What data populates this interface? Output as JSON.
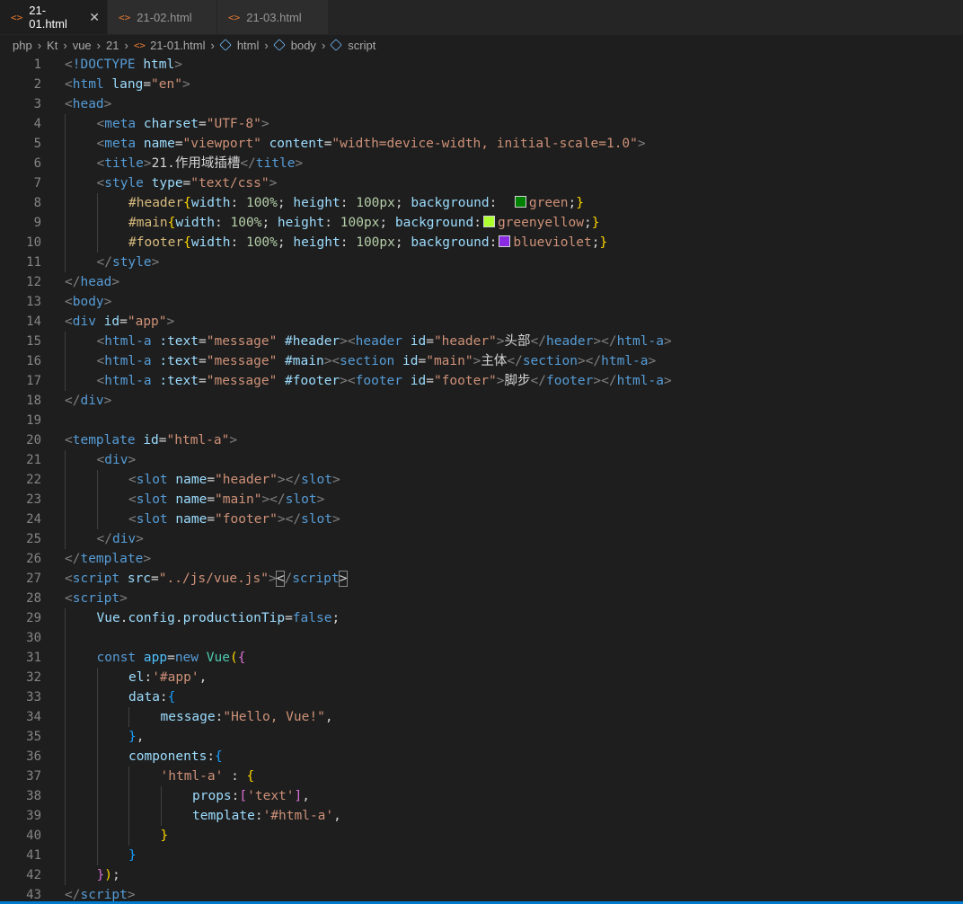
{
  "tabs": [
    {
      "label": "21-01.html",
      "active": true,
      "close": "✕"
    },
    {
      "label": "21-02.html",
      "active": false
    },
    {
      "label": "21-03.html",
      "active": false
    }
  ],
  "breadcrumb": [
    "php",
    "Kt",
    "vue",
    "21",
    "21-01.html",
    "html",
    "body",
    "script"
  ],
  "file_icon": "<>",
  "colors": {
    "green": "#008000",
    "greenyellow": "#adff2f",
    "blueviolet": "#8a2be2"
  },
  "lines": [
    {
      "n": "1",
      "i": 0,
      "t": [
        [
          "c-punc",
          "<"
        ],
        [
          "c-tag",
          "!DOCTYPE "
        ],
        [
          "c-attr",
          "html"
        ],
        [
          "c-punc",
          ">"
        ]
      ]
    },
    {
      "n": "2",
      "i": 0,
      "t": [
        [
          "c-punc",
          "<"
        ],
        [
          "c-tag",
          "html "
        ],
        [
          "c-attr",
          "lang"
        ],
        [
          "c-txt",
          "="
        ],
        [
          "c-str",
          "\"en\""
        ],
        [
          "c-punc",
          ">"
        ]
      ]
    },
    {
      "n": "3",
      "i": 0,
      "t": [
        [
          "c-punc",
          "<"
        ],
        [
          "c-tag",
          "head"
        ],
        [
          "c-punc",
          ">"
        ]
      ]
    },
    {
      "n": "4",
      "i": 1,
      "t": [
        [
          "c-punc",
          "<"
        ],
        [
          "c-tag",
          "meta "
        ],
        [
          "c-attr",
          "charset"
        ],
        [
          "c-txt",
          "="
        ],
        [
          "c-str",
          "\"UTF-8\""
        ],
        [
          "c-punc",
          ">"
        ]
      ]
    },
    {
      "n": "5",
      "i": 1,
      "t": [
        [
          "c-punc",
          "<"
        ],
        [
          "c-tag",
          "meta "
        ],
        [
          "c-attr",
          "name"
        ],
        [
          "c-txt",
          "="
        ],
        [
          "c-str",
          "\"viewport\" "
        ],
        [
          "c-attr",
          "content"
        ],
        [
          "c-txt",
          "="
        ],
        [
          "c-str",
          "\"width=device-width, initial-scale=1.0\""
        ],
        [
          "c-punc",
          ">"
        ]
      ]
    },
    {
      "n": "6",
      "i": 1,
      "t": [
        [
          "c-punc",
          "<"
        ],
        [
          "c-tag",
          "title"
        ],
        [
          "c-punc",
          ">"
        ],
        [
          "c-txt",
          "21.作用域插槽"
        ],
        [
          "c-punc",
          "</"
        ],
        [
          "c-tag",
          "title"
        ],
        [
          "c-punc",
          ">"
        ]
      ]
    },
    {
      "n": "7",
      "i": 1,
      "t": [
        [
          "c-punc",
          "<"
        ],
        [
          "c-tag",
          "style "
        ],
        [
          "c-attr",
          "type"
        ],
        [
          "c-txt",
          "="
        ],
        [
          "c-str",
          "\"text/css\""
        ],
        [
          "c-punc",
          ">"
        ]
      ]
    },
    {
      "n": "8",
      "i": 2,
      "t": [
        [
          "c-sel",
          "#header"
        ],
        [
          "c-br",
          "{"
        ],
        [
          "c-prop",
          "width"
        ],
        [
          "c-txt",
          ": "
        ],
        [
          "c-num",
          "100%"
        ],
        [
          "c-txt",
          "; "
        ],
        [
          "c-prop",
          "height"
        ],
        [
          "c-txt",
          ": "
        ],
        [
          "c-num",
          "100px"
        ],
        [
          "c-txt",
          "; "
        ],
        [
          "c-prop",
          "background"
        ],
        [
          "c-txt",
          ":  "
        ],
        [
          "swatch",
          "green"
        ],
        [
          "c-val",
          "green"
        ],
        [
          "c-txt",
          ";"
        ],
        [
          "c-br",
          "}"
        ]
      ]
    },
    {
      "n": "9",
      "i": 2,
      "t": [
        [
          "c-sel",
          "#main"
        ],
        [
          "c-br",
          "{"
        ],
        [
          "c-prop",
          "width"
        ],
        [
          "c-txt",
          ": "
        ],
        [
          "c-num",
          "100%"
        ],
        [
          "c-txt",
          "; "
        ],
        [
          "c-prop",
          "height"
        ],
        [
          "c-txt",
          ": "
        ],
        [
          "c-num",
          "100px"
        ],
        [
          "c-txt",
          "; "
        ],
        [
          "c-prop",
          "background"
        ],
        [
          "c-txt",
          ":"
        ],
        [
          "swatch",
          "greenyellow"
        ],
        [
          "c-val",
          "greenyellow"
        ],
        [
          "c-txt",
          ";"
        ],
        [
          "c-br",
          "}"
        ]
      ]
    },
    {
      "n": "10",
      "i": 2,
      "t": [
        [
          "c-sel",
          "#footer"
        ],
        [
          "c-br",
          "{"
        ],
        [
          "c-prop",
          "width"
        ],
        [
          "c-txt",
          ": "
        ],
        [
          "c-num",
          "100%"
        ],
        [
          "c-txt",
          "; "
        ],
        [
          "c-prop",
          "height"
        ],
        [
          "c-txt",
          ": "
        ],
        [
          "c-num",
          "100px"
        ],
        [
          "c-txt",
          "; "
        ],
        [
          "c-prop",
          "background"
        ],
        [
          "c-txt",
          ":"
        ],
        [
          "swatch",
          "blueviolet"
        ],
        [
          "c-val",
          "blueviolet"
        ],
        [
          "c-txt",
          ";"
        ],
        [
          "c-br",
          "}"
        ]
      ]
    },
    {
      "n": "11",
      "i": 1,
      "t": [
        [
          "c-punc",
          "</"
        ],
        [
          "c-tag",
          "style"
        ],
        [
          "c-punc",
          ">"
        ]
      ]
    },
    {
      "n": "12",
      "i": 0,
      "t": [
        [
          "c-punc",
          "</"
        ],
        [
          "c-tag",
          "head"
        ],
        [
          "c-punc",
          ">"
        ]
      ]
    },
    {
      "n": "13",
      "i": 0,
      "t": [
        [
          "c-punc",
          "<"
        ],
        [
          "c-tag",
          "body"
        ],
        [
          "c-punc",
          ">"
        ]
      ]
    },
    {
      "n": "14",
      "i": 0,
      "t": [
        [
          "c-punc",
          "<"
        ],
        [
          "c-tag",
          "div "
        ],
        [
          "c-attr",
          "id"
        ],
        [
          "c-txt",
          "="
        ],
        [
          "c-str",
          "\"app\""
        ],
        [
          "c-punc",
          ">"
        ]
      ]
    },
    {
      "n": "15",
      "i": 1,
      "t": [
        [
          "c-punc",
          "<"
        ],
        [
          "c-tag",
          "html-a "
        ],
        [
          "c-attr",
          ":text"
        ],
        [
          "c-txt",
          "="
        ],
        [
          "c-str",
          "\"message\" "
        ],
        [
          "c-attr",
          "#header"
        ],
        [
          "c-punc",
          "><"
        ],
        [
          "c-tag",
          "header "
        ],
        [
          "c-attr",
          "id"
        ],
        [
          "c-txt",
          "="
        ],
        [
          "c-str",
          "\"header\""
        ],
        [
          "c-punc",
          ">"
        ],
        [
          "c-txt",
          "头部"
        ],
        [
          "c-punc",
          "</"
        ],
        [
          "c-tag",
          "header"
        ],
        [
          "c-punc",
          "></"
        ],
        [
          "c-tag",
          "html-a"
        ],
        [
          "c-punc",
          ">"
        ]
      ]
    },
    {
      "n": "16",
      "i": 1,
      "t": [
        [
          "c-punc",
          "<"
        ],
        [
          "c-tag",
          "html-a "
        ],
        [
          "c-attr",
          ":text"
        ],
        [
          "c-txt",
          "="
        ],
        [
          "c-str",
          "\"message\" "
        ],
        [
          "c-attr",
          "#main"
        ],
        [
          "c-punc",
          "><"
        ],
        [
          "c-tag",
          "section "
        ],
        [
          "c-attr",
          "id"
        ],
        [
          "c-txt",
          "="
        ],
        [
          "c-str",
          "\"main\""
        ],
        [
          "c-punc",
          ">"
        ],
        [
          "c-txt",
          "主体"
        ],
        [
          "c-punc",
          "</"
        ],
        [
          "c-tag",
          "section"
        ],
        [
          "c-punc",
          "></"
        ],
        [
          "c-tag",
          "html-a"
        ],
        [
          "c-punc",
          ">"
        ]
      ]
    },
    {
      "n": "17",
      "i": 1,
      "t": [
        [
          "c-punc",
          "<"
        ],
        [
          "c-tag",
          "html-a "
        ],
        [
          "c-attr",
          ":text"
        ],
        [
          "c-txt",
          "="
        ],
        [
          "c-str",
          "\"message\" "
        ],
        [
          "c-attr",
          "#footer"
        ],
        [
          "c-punc",
          "><"
        ],
        [
          "c-tag",
          "footer "
        ],
        [
          "c-attr",
          "id"
        ],
        [
          "c-txt",
          "="
        ],
        [
          "c-str",
          "\"footer\""
        ],
        [
          "c-punc",
          ">"
        ],
        [
          "c-txt",
          "脚步"
        ],
        [
          "c-punc",
          "</"
        ],
        [
          "c-tag",
          "footer"
        ],
        [
          "c-punc",
          "></"
        ],
        [
          "c-tag",
          "html-a"
        ],
        [
          "c-punc",
          ">"
        ]
      ]
    },
    {
      "n": "18",
      "i": 0,
      "t": [
        [
          "c-punc",
          "</"
        ],
        [
          "c-tag",
          "div"
        ],
        [
          "c-punc",
          ">"
        ]
      ]
    },
    {
      "n": "19",
      "i": 0,
      "t": []
    },
    {
      "n": "20",
      "i": 0,
      "t": [
        [
          "c-punc",
          "<"
        ],
        [
          "c-tag",
          "template "
        ],
        [
          "c-attr",
          "id"
        ],
        [
          "c-txt",
          "="
        ],
        [
          "c-str",
          "\"html-a\""
        ],
        [
          "c-punc",
          ">"
        ]
      ]
    },
    {
      "n": "21",
      "i": 1,
      "t": [
        [
          "c-punc",
          "<"
        ],
        [
          "c-tag",
          "div"
        ],
        [
          "c-punc",
          ">"
        ]
      ]
    },
    {
      "n": "22",
      "i": 2,
      "t": [
        [
          "c-punc",
          "<"
        ],
        [
          "c-tag",
          "slot "
        ],
        [
          "c-attr",
          "name"
        ],
        [
          "c-txt",
          "="
        ],
        [
          "c-str",
          "\"header\""
        ],
        [
          "c-punc",
          "></"
        ],
        [
          "c-tag",
          "slot"
        ],
        [
          "c-punc",
          ">"
        ]
      ]
    },
    {
      "n": "23",
      "i": 2,
      "t": [
        [
          "c-punc",
          "<"
        ],
        [
          "c-tag",
          "slot "
        ],
        [
          "c-attr",
          "name"
        ],
        [
          "c-txt",
          "="
        ],
        [
          "c-str",
          "\"main\""
        ],
        [
          "c-punc",
          "></"
        ],
        [
          "c-tag",
          "slot"
        ],
        [
          "c-punc",
          ">"
        ]
      ]
    },
    {
      "n": "24",
      "i": 2,
      "t": [
        [
          "c-punc",
          "<"
        ],
        [
          "c-tag",
          "slot "
        ],
        [
          "c-attr",
          "name"
        ],
        [
          "c-txt",
          "="
        ],
        [
          "c-str",
          "\"footer\""
        ],
        [
          "c-punc",
          "></"
        ],
        [
          "c-tag",
          "slot"
        ],
        [
          "c-punc",
          ">"
        ]
      ]
    },
    {
      "n": "25",
      "i": 1,
      "t": [
        [
          "c-punc",
          "</"
        ],
        [
          "c-tag",
          "div"
        ],
        [
          "c-punc",
          ">"
        ]
      ]
    },
    {
      "n": "26",
      "i": 0,
      "t": [
        [
          "c-punc",
          "</"
        ],
        [
          "c-tag",
          "template"
        ],
        [
          "c-punc",
          ">"
        ]
      ]
    },
    {
      "n": "27",
      "i": 0,
      "t": [
        [
          "c-punc",
          "<"
        ],
        [
          "c-tag",
          "script "
        ],
        [
          "c-attr",
          "src"
        ],
        [
          "c-txt",
          "="
        ],
        [
          "c-str",
          "\"../js/vue.js\""
        ],
        [
          "c-punc",
          ">"
        ],
        [
          "c-bm",
          "<"
        ],
        [
          "c-punc",
          "/"
        ],
        [
          "c-tag",
          "script"
        ],
        [
          "c-bm",
          ">"
        ]
      ]
    },
    {
      "n": "28",
      "i": 0,
      "t": [
        [
          "c-punc",
          "<"
        ],
        [
          "c-tag",
          "script"
        ],
        [
          "c-punc",
          ">"
        ]
      ]
    },
    {
      "n": "29",
      "i": 1,
      "t": [
        [
          "c-var",
          "Vue"
        ],
        [
          "c-txt",
          "."
        ],
        [
          "c-var",
          "config"
        ],
        [
          "c-txt",
          "."
        ],
        [
          "c-var",
          "productionTip"
        ],
        [
          "c-txt",
          "="
        ],
        [
          "c-kw",
          "false"
        ],
        [
          "c-txt",
          ";"
        ]
      ]
    },
    {
      "n": "30",
      "i": 1,
      "t": []
    },
    {
      "n": "31",
      "i": 1,
      "t": [
        [
          "c-kw",
          "const "
        ],
        [
          "c-var2",
          "app"
        ],
        [
          "c-txt",
          "="
        ],
        [
          "c-kw",
          "new "
        ],
        [
          "c-cls",
          "Vue"
        ],
        [
          "c-br",
          "("
        ],
        [
          "c-br2",
          "{"
        ]
      ]
    },
    {
      "n": "32",
      "i": 2,
      "t": [
        [
          "c-var",
          "el"
        ],
        [
          "c-txt",
          ":"
        ],
        [
          "c-str",
          "'#app'"
        ],
        [
          "c-txt",
          ","
        ]
      ]
    },
    {
      "n": "33",
      "i": 2,
      "t": [
        [
          "c-var",
          "data"
        ],
        [
          "c-txt",
          ":"
        ],
        [
          "c-br3",
          "{"
        ]
      ]
    },
    {
      "n": "34",
      "i": 3,
      "t": [
        [
          "c-var",
          "message"
        ],
        [
          "c-txt",
          ":"
        ],
        [
          "c-str",
          "\"Hello, Vue!\""
        ],
        [
          "c-txt",
          ","
        ]
      ]
    },
    {
      "n": "35",
      "i": 2,
      "t": [
        [
          "c-br3",
          "}"
        ],
        [
          "c-txt",
          ","
        ]
      ]
    },
    {
      "n": "36",
      "i": 2,
      "t": [
        [
          "c-var",
          "components"
        ],
        [
          "c-txt",
          ":"
        ],
        [
          "c-br3",
          "{"
        ]
      ]
    },
    {
      "n": "37",
      "i": 3,
      "t": [
        [
          "c-str",
          "'html-a'"
        ],
        [
          "c-txt",
          " : "
        ],
        [
          "c-br",
          "{"
        ]
      ]
    },
    {
      "n": "38",
      "i": 4,
      "t": [
        [
          "c-var",
          "props"
        ],
        [
          "c-txt",
          ":"
        ],
        [
          "c-br2",
          "["
        ],
        [
          "c-str",
          "'text'"
        ],
        [
          "c-br2",
          "]"
        ],
        [
          "c-txt",
          ","
        ]
      ]
    },
    {
      "n": "39",
      "i": 4,
      "t": [
        [
          "c-var",
          "template"
        ],
        [
          "c-txt",
          ":"
        ],
        [
          "c-str",
          "'#html-a'"
        ],
        [
          "c-txt",
          ","
        ]
      ]
    },
    {
      "n": "40",
      "i": 3,
      "t": [
        [
          "c-br",
          "}"
        ]
      ]
    },
    {
      "n": "41",
      "i": 2,
      "t": [
        [
          "c-br3",
          "}"
        ]
      ]
    },
    {
      "n": "42",
      "i": 1,
      "t": [
        [
          "c-br2",
          "}"
        ],
        [
          "c-br",
          ")"
        ],
        [
          "c-txt",
          ";"
        ]
      ]
    },
    {
      "n": "43",
      "i": 0,
      "t": [
        [
          "c-punc",
          "</"
        ],
        [
          "c-tag",
          "script"
        ],
        [
          "c-punc",
          ">"
        ]
      ]
    }
  ]
}
